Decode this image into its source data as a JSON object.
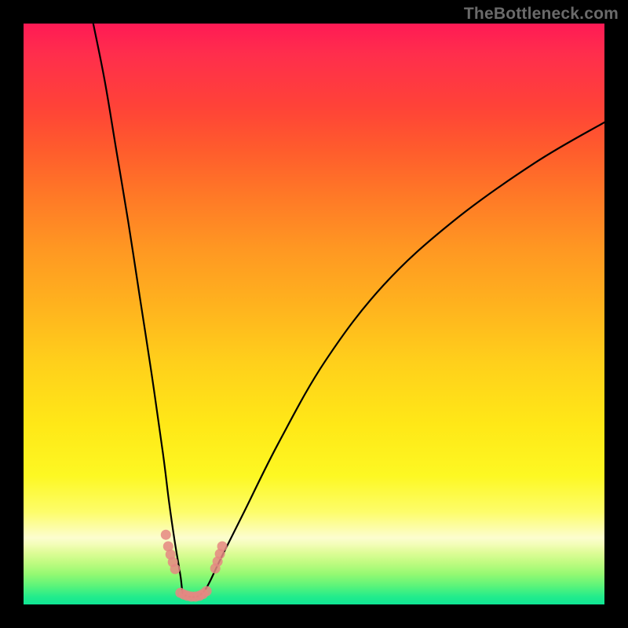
{
  "watermark": "TheBottleneck.com",
  "chart_data": {
    "type": "line",
    "title": "",
    "xlabel": "",
    "ylabel": "",
    "xlim": [
      0,
      100
    ],
    "ylim": [
      0,
      100
    ],
    "series": [
      {
        "name": "curve",
        "x": [
          12,
          14,
          16,
          18,
          20,
          22,
          24,
          25,
          26,
          27,
          27.4,
          28,
          29,
          30,
          31,
          32,
          34,
          38,
          44,
          52,
          62,
          74,
          88,
          100
        ],
        "y": [
          100,
          90,
          78,
          66,
          53,
          40,
          26,
          18,
          11,
          5,
          2,
          1.5,
          1.3,
          1.4,
          2.2,
          3.8,
          8,
          16,
          28,
          42,
          55,
          66,
          76,
          83
        ]
      }
    ],
    "markers": [
      {
        "x": 24.5,
        "y": 12
      },
      {
        "x": 24.9,
        "y": 10
      },
      {
        "x": 25.3,
        "y": 8.6
      },
      {
        "x": 25.7,
        "y": 7.3
      },
      {
        "x": 26.1,
        "y": 6.1
      },
      {
        "x": 27.0,
        "y": 2.0
      },
      {
        "x": 27.6,
        "y": 1.7
      },
      {
        "x": 28.2,
        "y": 1.5
      },
      {
        "x": 28.9,
        "y": 1.35
      },
      {
        "x": 29.6,
        "y": 1.35
      },
      {
        "x": 30.3,
        "y": 1.5
      },
      {
        "x": 30.9,
        "y": 1.8
      },
      {
        "x": 31.5,
        "y": 2.3
      },
      {
        "x": 33.0,
        "y": 6.2
      },
      {
        "x": 33.4,
        "y": 7.4
      },
      {
        "x": 33.8,
        "y": 8.7
      },
      {
        "x": 34.2,
        "y": 10.0
      }
    ],
    "background": {
      "type": "vertical-gradient",
      "top": "#ff1a55",
      "bottom": "#0ee694",
      "meaning": "red high / green low"
    }
  }
}
